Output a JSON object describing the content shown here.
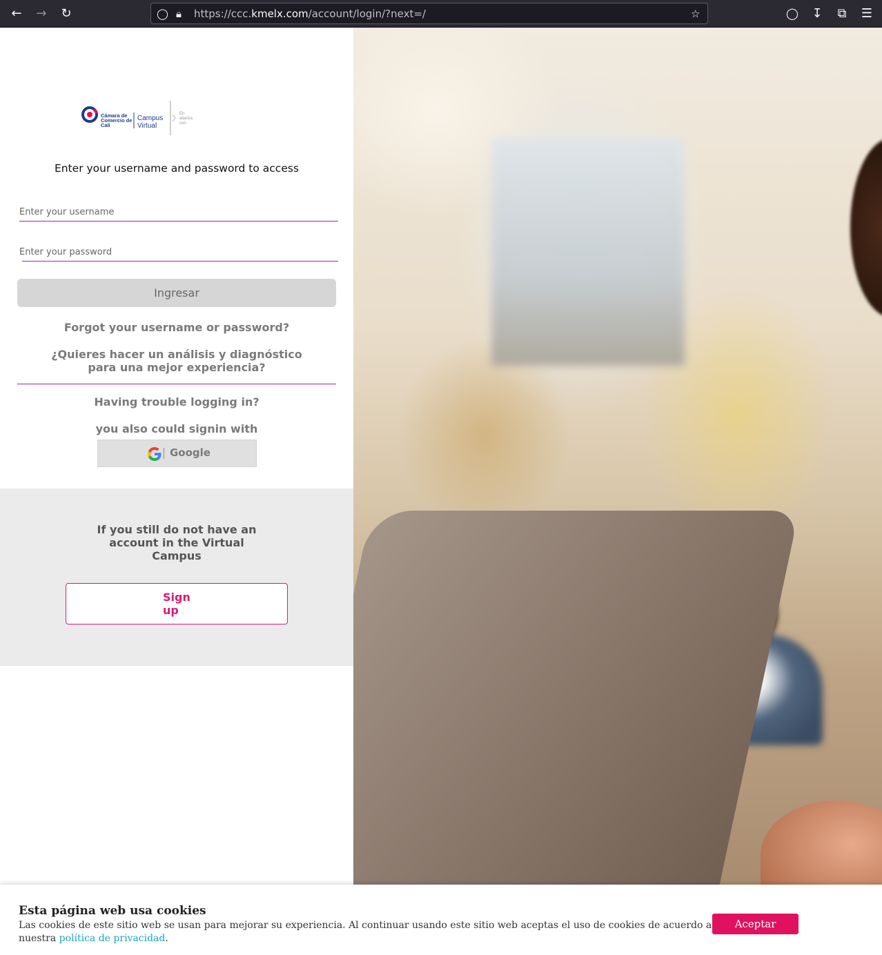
{
  "browser": {
    "url_prefix": "https://ccc.",
    "url_domain": "kmelx.com",
    "url_path": "/account/login/?next=/"
  },
  "logo": {
    "org_line1": "Cámara de",
    "org_line2": "Comercio de",
    "org_line3": "Cali",
    "product_line1": "Campus",
    "product_line2": "Virtual",
    "alliance_line1": "En",
    "alliance_line2": "alianza",
    "alliance_line3": "con"
  },
  "login": {
    "subtitle": "Enter your username and password to access",
    "username_placeholder": "Enter your username",
    "password_placeholder": "Enter your password",
    "submit_label": "Ingresar",
    "forgot_label": "Forgot your username or password?",
    "diagnostic_label": "¿Quieres hacer un análisis y diagnóstico para una mejor experiencia?",
    "trouble_label": "Having trouble logging in?",
    "signin_with_label": "you also could signin with",
    "google_label": "Google"
  },
  "register": {
    "prompt": "If you still do not have an account in the Virtual Campus",
    "signup_label": "Sign up"
  },
  "cookie": {
    "title": "Esta página web usa cookies",
    "text": "Las cookies de este sitio web se usan para mejorar su experiencia. Al continuar usando este sitio web aceptas el uso de cookies de acuerdo a nuestra ",
    "link_label": "política de privacidad",
    "text_end": ".",
    "accept_label": "Aceptar"
  },
  "colors": {
    "accent": "#9c27b0",
    "brand_pink": "#d81b72",
    "accept_bg": "#e0115f",
    "link": "#1ba3c4"
  }
}
